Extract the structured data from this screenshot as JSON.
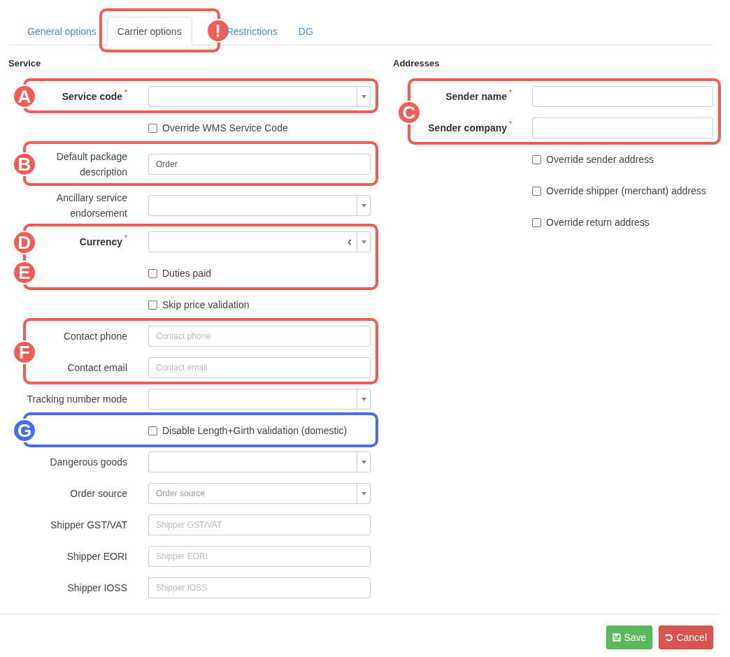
{
  "tabs": [
    {
      "label": "General options",
      "selected": false
    },
    {
      "label": "Carrier options",
      "selected": true,
      "callout": {
        "badges": [
          "!"
        ],
        "color": "#f25c54"
      }
    },
    {
      "label": "Restrictions",
      "selected": false
    },
    {
      "label": "DG",
      "selected": false
    }
  ],
  "service": {
    "title": "Service",
    "groups": [
      {
        "callout": {
          "badges": [
            "A"
          ],
          "color": "#f25c54"
        },
        "rows": [
          {
            "kind": "select",
            "label": "Service code",
            "required_mark": "*"
          }
        ]
      },
      {
        "rows": [
          {
            "kind": "checkbox",
            "label": "Override WMS Service Code",
            "checked": false
          }
        ]
      },
      {
        "callout": {
          "badges": [
            "B"
          ],
          "color": "#f25c54"
        },
        "rows": [
          {
            "kind": "input",
            "label": "Default package description",
            "value": "Order"
          }
        ]
      },
      {
        "rows": [
          {
            "kind": "select",
            "label": "Ancillary service endorsement"
          }
        ]
      },
      {
        "callout": {
          "badges": [
            "D",
            "E"
          ],
          "color": "#f25c54"
        },
        "rows": [
          {
            "kind": "select",
            "label": "Currency",
            "required_mark": "*",
            "loading": true
          },
          {
            "kind": "checkbox",
            "label": "Duties paid",
            "checked": false
          }
        ]
      },
      {
        "rows": [
          {
            "kind": "checkbox",
            "label": "Skip price validation",
            "checked": false
          }
        ]
      },
      {
        "callout": {
          "badges": [
            "F"
          ],
          "color": "#f25c54"
        },
        "rows": [
          {
            "kind": "input",
            "label": "Contact phone",
            "placeholder": "Contact phone"
          },
          {
            "kind": "input",
            "label": "Contact email",
            "placeholder": "Contact email"
          }
        ]
      },
      {
        "rows": [
          {
            "kind": "select",
            "label": "Tracking number mode"
          }
        ]
      },
      {
        "callout": {
          "badges": [
            "G"
          ],
          "color": "#4a6cf0"
        },
        "rows": [
          {
            "kind": "checkbox",
            "label": "Disable Length+Girth validation (domestic)",
            "checked": false
          }
        ]
      },
      {
        "rows": [
          {
            "kind": "select",
            "label": "Dangerous goods"
          },
          {
            "kind": "select",
            "label": "Order source",
            "placeholder": "Order source"
          },
          {
            "kind": "input",
            "label": "Shipper GST/VAT",
            "placeholder": "Shipper GST/VAT"
          },
          {
            "kind": "input",
            "label": "Shipper EORI",
            "placeholder": "Shipper EORI"
          },
          {
            "kind": "input",
            "label": "Shipper IOSS",
            "placeholder": "Shipper IOSS"
          }
        ]
      }
    ]
  },
  "addresses": {
    "title": "Addresses",
    "groups": [
      {
        "callout": {
          "badges": [
            "C"
          ],
          "color": "#f25c54"
        },
        "rows": [
          {
            "kind": "input",
            "label": "Sender name",
            "required_mark": "*"
          },
          {
            "kind": "input",
            "label": "Sender company",
            "required_mark": "*"
          }
        ]
      },
      {
        "rows": [
          {
            "kind": "checkbox",
            "label": "Override sender address",
            "checked": false
          },
          {
            "kind": "checkbox",
            "label": "Override shipper (merchant) address",
            "checked": false
          },
          {
            "kind": "checkbox",
            "label": "Override return address",
            "checked": false
          }
        ]
      }
    ]
  },
  "buttons": [
    {
      "kind": "save",
      "label": "Save"
    },
    {
      "kind": "cancel",
      "label": "Cancel"
    }
  ]
}
